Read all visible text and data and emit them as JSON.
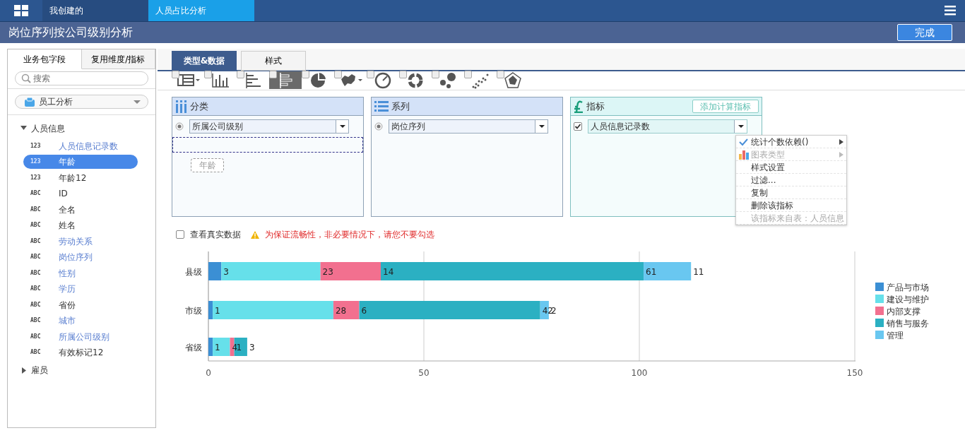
{
  "top_tabs": [
    {
      "label": "我创建的",
      "selected": false
    },
    {
      "label": "人员占比分析",
      "selected": true
    }
  ],
  "header": {
    "title": "岗位序列按公司级别分析",
    "done_button": "完成"
  },
  "side_tabs": [
    {
      "label": "业务包字段",
      "selected": true
    },
    {
      "label": "复用维度/指标",
      "selected": false
    }
  ],
  "search": {
    "placeholder": "搜索"
  },
  "package_select": {
    "value": "员工分析"
  },
  "tree": [
    {
      "label": "人员信息",
      "expanded": true,
      "children": [
        {
          "type_label": "123",
          "label": "人员信息记录数",
          "used": true,
          "selected": false
        },
        {
          "type_label": "123",
          "label": "年龄",
          "used": false,
          "selected": true
        },
        {
          "type_label": "123",
          "label": "年龄12",
          "used": false,
          "selected": false
        },
        {
          "type_label": "ABC",
          "label": "ID",
          "used": false,
          "selected": false
        },
        {
          "type_label": "ABC",
          "label": "全名",
          "used": false,
          "selected": false
        },
        {
          "type_label": "ABC",
          "label": "姓名",
          "used": false,
          "selected": false
        },
        {
          "type_label": "ABC",
          "label": "劳动关系",
          "used": true,
          "selected": false
        },
        {
          "type_label": "ABC",
          "label": "岗位序列",
          "used": true,
          "selected": false
        },
        {
          "type_label": "ABC",
          "label": "性别",
          "used": true,
          "selected": false
        },
        {
          "type_label": "ABC",
          "label": "学历",
          "used": true,
          "selected": false
        },
        {
          "type_label": "ABC",
          "label": "省份",
          "used": false,
          "selected": false
        },
        {
          "type_label": "ABC",
          "label": "城市",
          "used": true,
          "selected": false
        },
        {
          "type_label": "ABC",
          "label": "所属公司级别",
          "used": true,
          "selected": false
        },
        {
          "type_label": "ABC",
          "label": "有效标记12",
          "used": false,
          "selected": false
        }
      ]
    },
    {
      "label": "雇员",
      "expanded": false
    }
  ],
  "editor_tabs": [
    {
      "label": "类型&数据",
      "selected": true
    },
    {
      "label": "样式",
      "selected": false
    }
  ],
  "chart_types": [
    {
      "kind": "table",
      "selected": false,
      "has_menu": true
    },
    {
      "kind": "column",
      "selected": false,
      "has_menu": false
    },
    {
      "kind": "bar",
      "selected": false,
      "has_menu": false
    },
    {
      "kind": "stacked-bar",
      "selected": true,
      "has_menu": false
    },
    {
      "kind": "pie",
      "selected": false,
      "has_menu": false
    },
    {
      "kind": "map",
      "selected": false,
      "has_menu": true
    },
    {
      "kind": "gauge",
      "selected": false,
      "has_menu": false
    },
    {
      "kind": "donut",
      "selected": false,
      "has_menu": false
    },
    {
      "kind": "bubble",
      "selected": false,
      "has_menu": false
    },
    {
      "kind": "scatter",
      "selected": false,
      "has_menu": false
    },
    {
      "kind": "radar",
      "selected": false,
      "has_menu": false
    }
  ],
  "regions": [
    {
      "kind": "category",
      "title": "分类",
      "fields": [
        {
          "label": "所属公司级别",
          "selected": true
        }
      ],
      "drop_target": true,
      "drag_item": "年龄"
    },
    {
      "kind": "series",
      "title": "系列",
      "fields": [
        {
          "label": "岗位序列",
          "selected": true
        }
      ]
    },
    {
      "kind": "measure",
      "title": "指标",
      "action": "添加计算指标",
      "fields": [
        {
          "label": "人员信息记录数",
          "checked": true,
          "menu_open": true
        }
      ]
    }
  ],
  "field_menu": [
    {
      "label": "统计个数依赖()",
      "checked": true,
      "submenu": true,
      "disabled": false,
      "kind": "check"
    },
    {
      "label": "图表类型",
      "checked": false,
      "submenu": true,
      "disabled": true,
      "kind": "chart"
    },
    {
      "label": "样式设置",
      "checked": false,
      "submenu": false,
      "disabled": false,
      "kind": "plain"
    },
    {
      "label": "过滤...",
      "checked": false,
      "submenu": false,
      "disabled": false,
      "kind": "plain"
    },
    {
      "label": "复制",
      "checked": false,
      "submenu": false,
      "disabled": false,
      "kind": "plain"
    },
    {
      "label": "删除该指标",
      "checked": false,
      "submenu": false,
      "disabled": false,
      "kind": "plain"
    },
    {
      "label": "该指标来自表：人员信息",
      "checked": false,
      "submenu": false,
      "disabled": true,
      "kind": "plain"
    }
  ],
  "real_data": {
    "label": "查看真实数据",
    "checked": false,
    "warning": "为保证流畅性，非必要情况下，请您不要勾选"
  },
  "chart_data": {
    "type": "bar",
    "orientation": "horizontal",
    "stacked": true,
    "data_labels": true,
    "categories": [
      "县级",
      "市级",
      "省级"
    ],
    "series": [
      {
        "name": "产品与市场",
        "color": "#3b8fd4",
        "values": [
          3,
          1,
          1
        ]
      },
      {
        "name": "建设与维护",
        "color": "#66e0ea",
        "values": [
          23,
          28,
          4
        ]
      },
      {
        "name": "内部支撑",
        "color": "#f2708f",
        "values": [
          14,
          6,
          1
        ]
      },
      {
        "name": "销售与服务",
        "color": "#2bb0c2",
        "values": [
          61,
          42,
          3
        ]
      },
      {
        "name": "管理",
        "color": "#69c7f0",
        "values": [
          11,
          2,
          null
        ]
      }
    ],
    "xlim": [
      0,
      150
    ],
    "xticks": [
      0,
      50,
      100,
      150
    ],
    "legend": "right"
  }
}
